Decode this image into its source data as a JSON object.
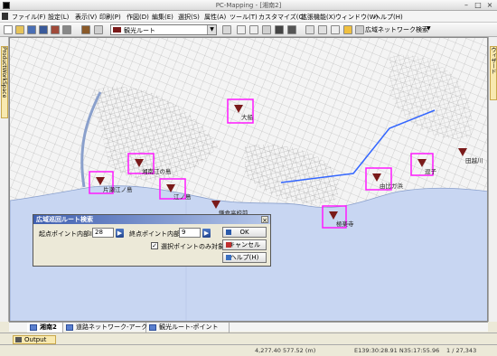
{
  "window": {
    "title": "PC-Mapping - [湘南2]"
  },
  "menu": [
    "ファイル(F)",
    "設定(L)",
    "表示(V)",
    "印刷(P)",
    "作図(D)",
    "編集(E)",
    "選択(S)",
    "属性(A)",
    "ツール(T)",
    "カスタマイズ(C)",
    "拡張機能(X)",
    "ウィンドウ(W)",
    "ヘルプ(H)"
  ],
  "toolbar": {
    "layer_select": "観光ルート",
    "network_search": "広域ネットワーク検索"
  },
  "side": {
    "left_tab": "ProductWorkSpace",
    "right_tab": "ウィザード"
  },
  "map": {
    "pois": [
      {
        "label": "大船"
      },
      {
        "label": "湘南江の島"
      },
      {
        "label": "江ノ島"
      },
      {
        "label": "片瀬江ノ島"
      },
      {
        "label": "鎌倉高校前"
      },
      {
        "label": "極楽寺"
      },
      {
        "label": "由比ガ浜"
      },
      {
        "label": "逗子"
      },
      {
        "label": "田越川"
      }
    ]
  },
  "dialog": {
    "title": "広域巡回ルート検索",
    "start_label": "起点ポイント内部ID",
    "start_value": "28",
    "end_label": "終点ポイント内部ID",
    "end_value": "9",
    "checkbox_label": "選択ポイントのみ対象",
    "checkbox_checked": true,
    "ok": "OK",
    "cancel": "キャンセル",
    "help": "ヘルプ(H)"
  },
  "tabs": [
    "湘南2",
    "道路ネットワーク-アーク",
    "観光ルート-ポイント"
  ],
  "output": {
    "label": "Output"
  },
  "status": {
    "coords": "4,277.40 577.52 (m)",
    "geo": "E139:30:28.91 N35:17:55.96",
    "scale": "1 / 27,343"
  },
  "colors": {
    "highlight": "#ff1aff",
    "poi": "#7a1a1a",
    "sea": "#c8d6f2",
    "route": "#3366ff"
  }
}
